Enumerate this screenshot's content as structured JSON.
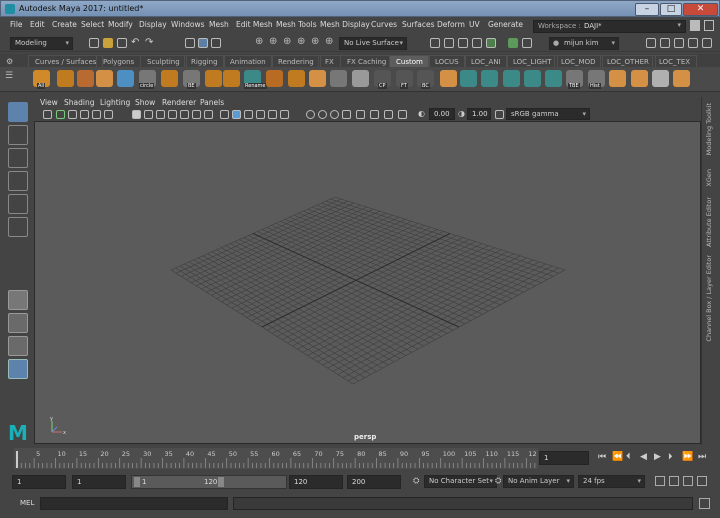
{
  "window": {
    "title": "Autodesk Maya 2017: untitled*",
    "min": "–",
    "max": "□",
    "close": "✕"
  },
  "menu": [
    "File",
    "Edit",
    "Create",
    "Select",
    "Modify",
    "Display",
    "Windows",
    "Mesh",
    "Edit Mesh",
    "Mesh Tools",
    "Mesh Display",
    "Curves",
    "Surfaces",
    "Deform",
    "UV",
    "Generate"
  ],
  "workspace": {
    "label": "Workspace :",
    "value": "DAJI*"
  },
  "toolbar": {
    "mode": "Modeling",
    "live_surface": "No Live Surface",
    "user": "mijun kim"
  },
  "shelf_tabs": [
    "Curves / Surfaces",
    "Polygons",
    "Sculpting",
    "Rigging",
    "Animation",
    "Rendering",
    "FX",
    "FX Caching",
    "Custom",
    "LOCUS",
    "LOC_ANI",
    "LOC_LIGHT",
    "LOC_MOD",
    "LOC_OTHER",
    "LOC_TEX"
  ],
  "shelf_active": "Custom",
  "shelf_labels": [
    "All",
    "circle",
    "BE",
    "Rename",
    "CP",
    "FT",
    "BC",
    "TBE",
    "Hist"
  ],
  "panel_menu": [
    "View",
    "Shading",
    "Lighting",
    "Show",
    "Renderer",
    "Panels"
  ],
  "panel_toolbar": {
    "exposure": "0.00",
    "gamma": "1.00",
    "colorspace": "sRGB gamma"
  },
  "viewport": {
    "camera_label": "persp",
    "axis_y": "y",
    "axis_x": "x"
  },
  "right_tabs": [
    "Modeling Toolkit",
    "XGen",
    "Attribute Editor",
    "Channel Box / Layer Editor"
  ],
  "timeline": {
    "ticks": [
      "5",
      "10",
      "15",
      "20",
      "25",
      "30",
      "35",
      "40",
      "45",
      "50",
      "55",
      "60",
      "65",
      "70",
      "75",
      "80",
      "85",
      "90",
      "95",
      "100",
      "105",
      "110",
      "115",
      "12"
    ],
    "current_frame": "1"
  },
  "range": {
    "start": "1",
    "start2": "1",
    "slider_start": "1",
    "slider_end": "120",
    "end": "120",
    "end2": "200",
    "character_set": "No Character Set",
    "anim_layer": "No Anim Layer",
    "fps": "24 fps"
  },
  "cmdline": {
    "label": "MEL"
  }
}
